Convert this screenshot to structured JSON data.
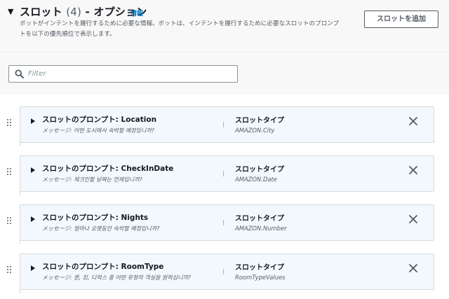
{
  "section": {
    "title_main": "スロット",
    "title_count": "(4)",
    "title_suffix": "- オプション",
    "info_link": "情報",
    "description": "ボットがインテントを履行するために必要な情報。ボットは、インテントを履行するために必要なスロットのプロンプトを以下の優先順位で表示します。",
    "add_button": "スロットを追加"
  },
  "filter": {
    "placeholder": "Filter"
  },
  "icons": {
    "section_toggle": "caret-down-icon",
    "search": "search-icon",
    "drag": "drag-handle-icon",
    "expand": "caret-right-icon",
    "remove": "close-icon"
  },
  "slots": [
    {
      "prompt_label": "スロットのプロンプト: Location",
      "message": "メッセージ: 어떤 도시에서 숙박할 예정입니까?",
      "type_label": "スロットタイプ",
      "type_value": "AMAZON.City"
    },
    {
      "prompt_label": "スロットのプロンプト: CheckInDate",
      "message": "メッセージ: 체크인할 날짜는 언제입니까?",
      "type_label": "スロットタイプ",
      "type_value": "AMAZON.Date"
    },
    {
      "prompt_label": "スロットのプロンプト: Nights",
      "message": "メッセージ: 얼마나 오랫동안 숙박할 예정입니까?",
      "type_label": "スロットタイプ",
      "type_value": "AMAZON.Number"
    },
    {
      "prompt_label": "スロットのプロンプト: RoomType",
      "message": "メッセージ: 퀸, 킹, 디럭스 중 어떤 유형의 객실을 원하십니까?",
      "type_label": "スロットタイプ",
      "type_value": "RoomTypeValues"
    }
  ],
  "colors": {
    "link": "#0073bb",
    "card_background": "#f2f8fd",
    "card_border": "#d5dbdb",
    "header_background": "#f8f8f8"
  }
}
